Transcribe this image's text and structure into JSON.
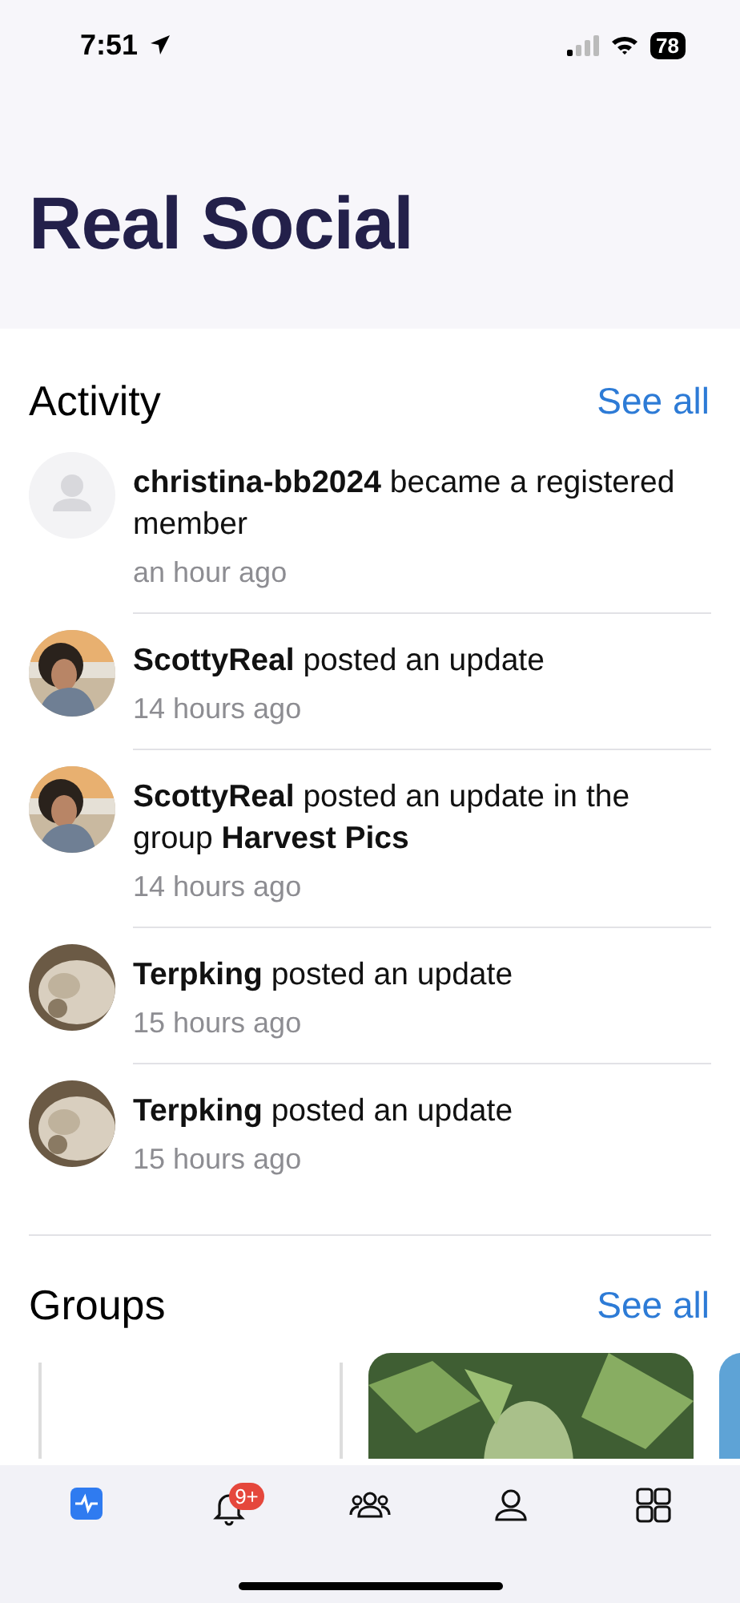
{
  "status_bar": {
    "time": "7:51",
    "battery": "78"
  },
  "header": {
    "title": "Real Social"
  },
  "activity": {
    "title": "Activity",
    "see_all": "See all",
    "items": [
      {
        "kind": "default",
        "text": "**christina-bb2024** became a registered member",
        "time": "an hour ago"
      },
      {
        "kind": "person",
        "text": "**ScottyReal** posted an update",
        "time": "14 hours ago"
      },
      {
        "kind": "person",
        "text": "**ScottyReal** posted an update in the group **Harvest Pics**",
        "time": "14 hours ago"
      },
      {
        "kind": "cat",
        "text": "**Terpking** posted an update",
        "time": "15 hours ago"
      },
      {
        "kind": "cat",
        "text": "**Terpking** posted an update",
        "time": "15 hours ago"
      }
    ]
  },
  "groups": {
    "title": "Groups",
    "see_all": "See all",
    "cards": [
      {
        "kind": "logo"
      },
      {
        "kind": "picture"
      },
      {
        "kind": "blank"
      }
    ]
  },
  "tab_bar": {
    "tabs": [
      {
        "kind": "activity",
        "selected": true
      },
      {
        "kind": "bell",
        "selected": false,
        "badge": "9+"
      },
      {
        "kind": "groups",
        "selected": false
      },
      {
        "kind": "profile",
        "selected": false
      },
      {
        "kind": "grid",
        "selected": false
      }
    ]
  }
}
